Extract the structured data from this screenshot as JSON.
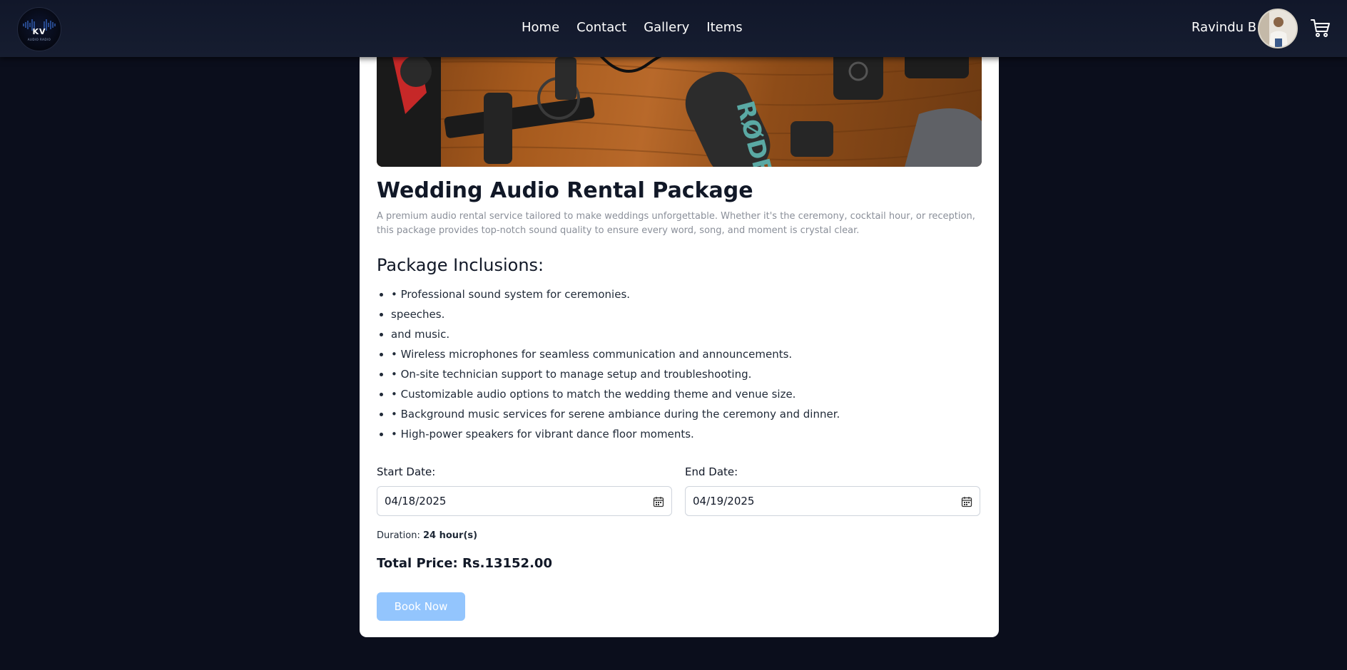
{
  "nav": {
    "logo_text": "KV",
    "logo_sub": "AUDIO RADIO",
    "links": [
      "Home",
      "Contact",
      "Gallery",
      "Items"
    ],
    "user_name": "Ravindu B"
  },
  "product": {
    "title": "Wedding Audio Rental Package",
    "description": "A premium audio rental service tailored to make weddings unforgettable. Whether it's the ceremony, cocktail hour, or reception, this package provides top-notch sound quality to ensure every word, song, and moment is crystal clear.",
    "inclusions_heading": "Package Inclusions:",
    "inclusions": [
      "• Professional sound system for ceremonies.",
      "speeches.",
      "and music.",
      "• Wireless microphones for seamless communication and announcements.",
      "• On-site technician support to manage setup and troubleshooting.",
      "• Customizable audio options to match the wedding theme and venue size.",
      "• Background music services for serene ambiance during the ceremony and dinner.",
      "• High-power speakers for vibrant dance floor moments."
    ]
  },
  "booking": {
    "start_label": "Start Date:",
    "start_value": "04/18/2025",
    "end_label": "End Date:",
    "end_value": "04/19/2025",
    "duration_label": "Duration:",
    "duration_value": "24 hour(s)",
    "total_label": "Total Price:",
    "total_value": "Rs.13152.00",
    "book_button": "Book Now"
  },
  "colors": {
    "page_bg": "#0b0e1c",
    "navbar_bg": "#161d30",
    "card_bg": "#ffffff",
    "button_bg": "#93c5fd",
    "muted_text": "#8a8f99"
  },
  "icons": [
    "logo-icon",
    "avatar",
    "cart-icon",
    "calendar-icon"
  ]
}
